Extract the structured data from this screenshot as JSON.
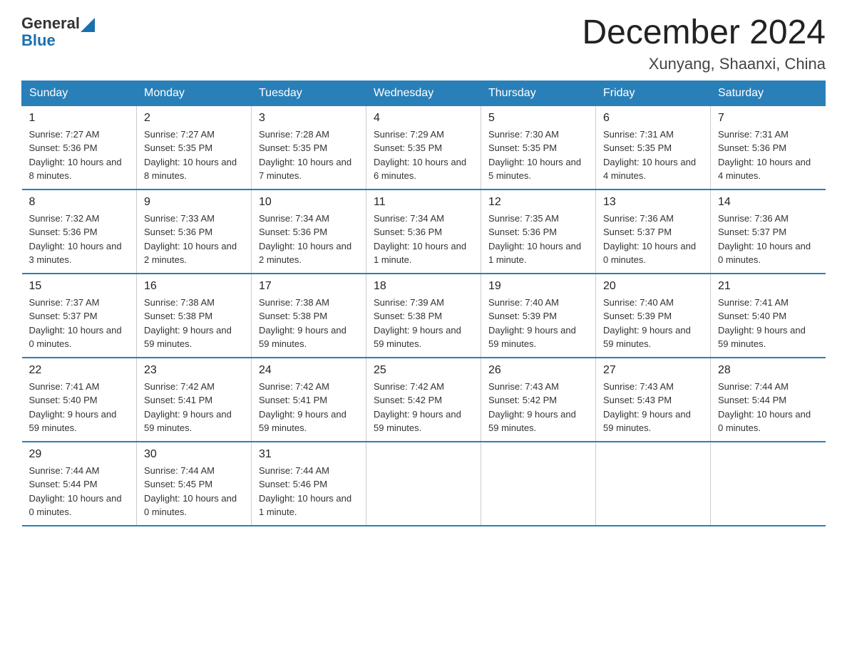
{
  "logo": {
    "general": "General",
    "blue": "Blue"
  },
  "title": "December 2024",
  "location": "Xunyang, Shaanxi, China",
  "weekdays": [
    "Sunday",
    "Monday",
    "Tuesday",
    "Wednesday",
    "Thursday",
    "Friday",
    "Saturday"
  ],
  "weeks": [
    [
      {
        "day": "1",
        "sunrise": "7:27 AM",
        "sunset": "5:36 PM",
        "daylight": "10 hours and 8 minutes."
      },
      {
        "day": "2",
        "sunrise": "7:27 AM",
        "sunset": "5:35 PM",
        "daylight": "10 hours and 8 minutes."
      },
      {
        "day": "3",
        "sunrise": "7:28 AM",
        "sunset": "5:35 PM",
        "daylight": "10 hours and 7 minutes."
      },
      {
        "day": "4",
        "sunrise": "7:29 AM",
        "sunset": "5:35 PM",
        "daylight": "10 hours and 6 minutes."
      },
      {
        "day": "5",
        "sunrise": "7:30 AM",
        "sunset": "5:35 PM",
        "daylight": "10 hours and 5 minutes."
      },
      {
        "day": "6",
        "sunrise": "7:31 AM",
        "sunset": "5:35 PM",
        "daylight": "10 hours and 4 minutes."
      },
      {
        "day": "7",
        "sunrise": "7:31 AM",
        "sunset": "5:36 PM",
        "daylight": "10 hours and 4 minutes."
      }
    ],
    [
      {
        "day": "8",
        "sunrise": "7:32 AM",
        "sunset": "5:36 PM",
        "daylight": "10 hours and 3 minutes."
      },
      {
        "day": "9",
        "sunrise": "7:33 AM",
        "sunset": "5:36 PM",
        "daylight": "10 hours and 2 minutes."
      },
      {
        "day": "10",
        "sunrise": "7:34 AM",
        "sunset": "5:36 PM",
        "daylight": "10 hours and 2 minutes."
      },
      {
        "day": "11",
        "sunrise": "7:34 AM",
        "sunset": "5:36 PM",
        "daylight": "10 hours and 1 minute."
      },
      {
        "day": "12",
        "sunrise": "7:35 AM",
        "sunset": "5:36 PM",
        "daylight": "10 hours and 1 minute."
      },
      {
        "day": "13",
        "sunrise": "7:36 AM",
        "sunset": "5:37 PM",
        "daylight": "10 hours and 0 minutes."
      },
      {
        "day": "14",
        "sunrise": "7:36 AM",
        "sunset": "5:37 PM",
        "daylight": "10 hours and 0 minutes."
      }
    ],
    [
      {
        "day": "15",
        "sunrise": "7:37 AM",
        "sunset": "5:37 PM",
        "daylight": "10 hours and 0 minutes."
      },
      {
        "day": "16",
        "sunrise": "7:38 AM",
        "sunset": "5:38 PM",
        "daylight": "9 hours and 59 minutes."
      },
      {
        "day": "17",
        "sunrise": "7:38 AM",
        "sunset": "5:38 PM",
        "daylight": "9 hours and 59 minutes."
      },
      {
        "day": "18",
        "sunrise": "7:39 AM",
        "sunset": "5:38 PM",
        "daylight": "9 hours and 59 minutes."
      },
      {
        "day": "19",
        "sunrise": "7:40 AM",
        "sunset": "5:39 PM",
        "daylight": "9 hours and 59 minutes."
      },
      {
        "day": "20",
        "sunrise": "7:40 AM",
        "sunset": "5:39 PM",
        "daylight": "9 hours and 59 minutes."
      },
      {
        "day": "21",
        "sunrise": "7:41 AM",
        "sunset": "5:40 PM",
        "daylight": "9 hours and 59 minutes."
      }
    ],
    [
      {
        "day": "22",
        "sunrise": "7:41 AM",
        "sunset": "5:40 PM",
        "daylight": "9 hours and 59 minutes."
      },
      {
        "day": "23",
        "sunrise": "7:42 AM",
        "sunset": "5:41 PM",
        "daylight": "9 hours and 59 minutes."
      },
      {
        "day": "24",
        "sunrise": "7:42 AM",
        "sunset": "5:41 PM",
        "daylight": "9 hours and 59 minutes."
      },
      {
        "day": "25",
        "sunrise": "7:42 AM",
        "sunset": "5:42 PM",
        "daylight": "9 hours and 59 minutes."
      },
      {
        "day": "26",
        "sunrise": "7:43 AM",
        "sunset": "5:42 PM",
        "daylight": "9 hours and 59 minutes."
      },
      {
        "day": "27",
        "sunrise": "7:43 AM",
        "sunset": "5:43 PM",
        "daylight": "9 hours and 59 minutes."
      },
      {
        "day": "28",
        "sunrise": "7:44 AM",
        "sunset": "5:44 PM",
        "daylight": "10 hours and 0 minutes."
      }
    ],
    [
      {
        "day": "29",
        "sunrise": "7:44 AM",
        "sunset": "5:44 PM",
        "daylight": "10 hours and 0 minutes."
      },
      {
        "day": "30",
        "sunrise": "7:44 AM",
        "sunset": "5:45 PM",
        "daylight": "10 hours and 0 minutes."
      },
      {
        "day": "31",
        "sunrise": "7:44 AM",
        "sunset": "5:46 PM",
        "daylight": "10 hours and 1 minute."
      },
      null,
      null,
      null,
      null
    ]
  ]
}
